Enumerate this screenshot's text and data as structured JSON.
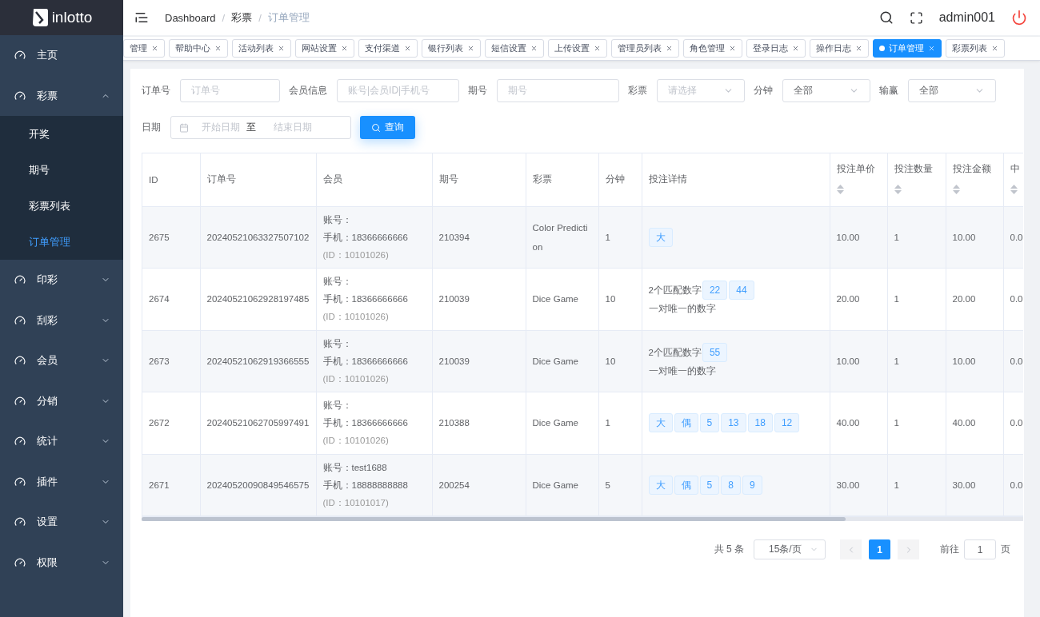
{
  "sidebar": {
    "logo": "inlotto",
    "items": [
      {
        "label": "主页",
        "kind": "link"
      },
      {
        "label": "彩票",
        "kind": "menu",
        "expanded": true,
        "children": [
          {
            "label": "开奖",
            "selected": false
          },
          {
            "label": "期号",
            "selected": false
          },
          {
            "label": "彩票列表",
            "selected": false
          },
          {
            "label": "订单管理",
            "selected": true
          }
        ]
      },
      {
        "label": "印彩",
        "kind": "menu",
        "expanded": false
      },
      {
        "label": "刮彩",
        "kind": "menu",
        "expanded": false
      },
      {
        "label": "会员",
        "kind": "menu",
        "expanded": false
      },
      {
        "label": "分销",
        "kind": "menu",
        "expanded": false
      },
      {
        "label": "统计",
        "kind": "menu",
        "expanded": false
      },
      {
        "label": "插件",
        "kind": "menu",
        "expanded": false
      },
      {
        "label": "设置",
        "kind": "menu",
        "expanded": false
      },
      {
        "label": "权限",
        "kind": "menu",
        "expanded": false
      }
    ]
  },
  "breadcrumb": [
    "Dashboard",
    "彩票",
    "订单管理"
  ],
  "breadcrumb_separator": "/",
  "user": "admin001",
  "tabs": [
    {
      "label": "管理",
      "selected": false
    },
    {
      "label": "帮助中心",
      "selected": false
    },
    {
      "label": "活动列表",
      "selected": false
    },
    {
      "label": "网站设置",
      "selected": false
    },
    {
      "label": "支付渠道",
      "selected": false
    },
    {
      "label": "银行列表",
      "selected": false
    },
    {
      "label": "短信设置",
      "selected": false
    },
    {
      "label": "上传设置",
      "selected": false
    },
    {
      "label": "管理员列表",
      "selected": false
    },
    {
      "label": "角色管理",
      "selected": false
    },
    {
      "label": "登录日志",
      "selected": false
    },
    {
      "label": "操作日志",
      "selected": false
    },
    {
      "label": "订单管理",
      "selected": true
    },
    {
      "label": "彩票列表",
      "selected": false
    }
  ],
  "filters": [
    {
      "label": "订单号",
      "kind": "input",
      "placeholder": "订单号"
    },
    {
      "label": "会员信息",
      "kind": "input",
      "placeholder": "账号|会员ID|手机号"
    },
    {
      "label": "期号",
      "kind": "input",
      "placeholder": "期号"
    },
    {
      "label": "彩票",
      "kind": "select",
      "placeholder": "请选择"
    },
    {
      "label": "分钟",
      "kind": "select",
      "value": "全部"
    },
    {
      "label": "输赢",
      "kind": "select",
      "value": "全部"
    }
  ],
  "date_filter": {
    "label": "日期",
    "start_placeholder": "开始日期",
    "separator": "至",
    "end_placeholder": "结束日期"
  },
  "search_button": "查询",
  "table": {
    "columns": [
      {
        "label": "ID",
        "sortable": false
      },
      {
        "label": "订单号",
        "sortable": false
      },
      {
        "label": "会员",
        "sortable": false
      },
      {
        "label": "期号",
        "sortable": false
      },
      {
        "label": "彩票",
        "sortable": false
      },
      {
        "label": "分钟",
        "sortable": false
      },
      {
        "label": "投注详情",
        "sortable": false
      },
      {
        "label": "投注单价",
        "sortable": true
      },
      {
        "label": "投注数量",
        "sortable": true
      },
      {
        "label": "投注金额",
        "sortable": true
      },
      {
        "label": "中",
        "sortable": true
      }
    ],
    "rows": [
      {
        "id": "2675",
        "order": "20240521063327507102",
        "account": "账号：",
        "phone": "手机：18366666666",
        "member_id": "(ID：10101026)",
        "issue": "210394",
        "lottery": "Color Prediction",
        "minutes": "1",
        "details": [
          {
            "tags": [
              "大"
            ]
          }
        ],
        "price": "10.00",
        "quantity": "1",
        "amount": "10.00",
        "column_11": "0.0"
      },
      {
        "id": "2674",
        "order": "20240521062928197485",
        "account": "账号：",
        "phone": "手机：18366666666",
        "member_id": "(ID：10101026)",
        "issue": "210039",
        "lottery": "Dice Game",
        "minutes": "10",
        "details": [
          {
            "text": "2个匹配数字",
            "tags": [
              "22",
              "44"
            ]
          },
          {
            "text": "一对唯一的数字"
          }
        ],
        "price": "20.00",
        "quantity": "1",
        "amount": "20.00",
        "column_11": "0.0"
      },
      {
        "id": "2673",
        "order": "20240521062919366555",
        "account": "账号：",
        "phone": "手机：18366666666",
        "member_id": "(ID：10101026)",
        "issue": "210039",
        "lottery": "Dice Game",
        "minutes": "10",
        "details": [
          {
            "text": "2个匹配数字",
            "tags": [
              "55"
            ]
          },
          {
            "text": "一对唯一的数字"
          }
        ],
        "price": "10.00",
        "quantity": "1",
        "amount": "10.00",
        "column_11": "0.0"
      },
      {
        "id": "2672",
        "order": "20240521062705997491",
        "account": "账号：",
        "phone": "手机：18366666666",
        "member_id": "(ID：10101026)",
        "issue": "210388",
        "lottery": "Dice Game",
        "minutes": "1",
        "details": [
          {
            "tags": [
              "大",
              "偶",
              "5",
              "13",
              "18",
              "12"
            ]
          }
        ],
        "price": "40.00",
        "quantity": "1",
        "amount": "40.00",
        "column_11": "0.0"
      },
      {
        "id": "2671",
        "order": "20240520090849546575",
        "account": "账号：test1688",
        "phone": "手机：18888888888",
        "member_id": "(ID：10101017)",
        "issue": "200254",
        "lottery": "Dice Game",
        "minutes": "5",
        "details": [
          {
            "tags": [
              "大",
              "偶",
              "5",
              "8",
              "9"
            ]
          }
        ],
        "price": "30.00",
        "quantity": "1",
        "amount": "30.00",
        "column_11": "0.0"
      }
    ]
  },
  "pagination": {
    "total": "共 5 条",
    "page_size": "15条/页",
    "pages": [
      {
        "label": "1",
        "selected": true
      }
    ],
    "goto_label": "前往",
    "goto_value": "1",
    "page_suffix": "页"
  }
}
